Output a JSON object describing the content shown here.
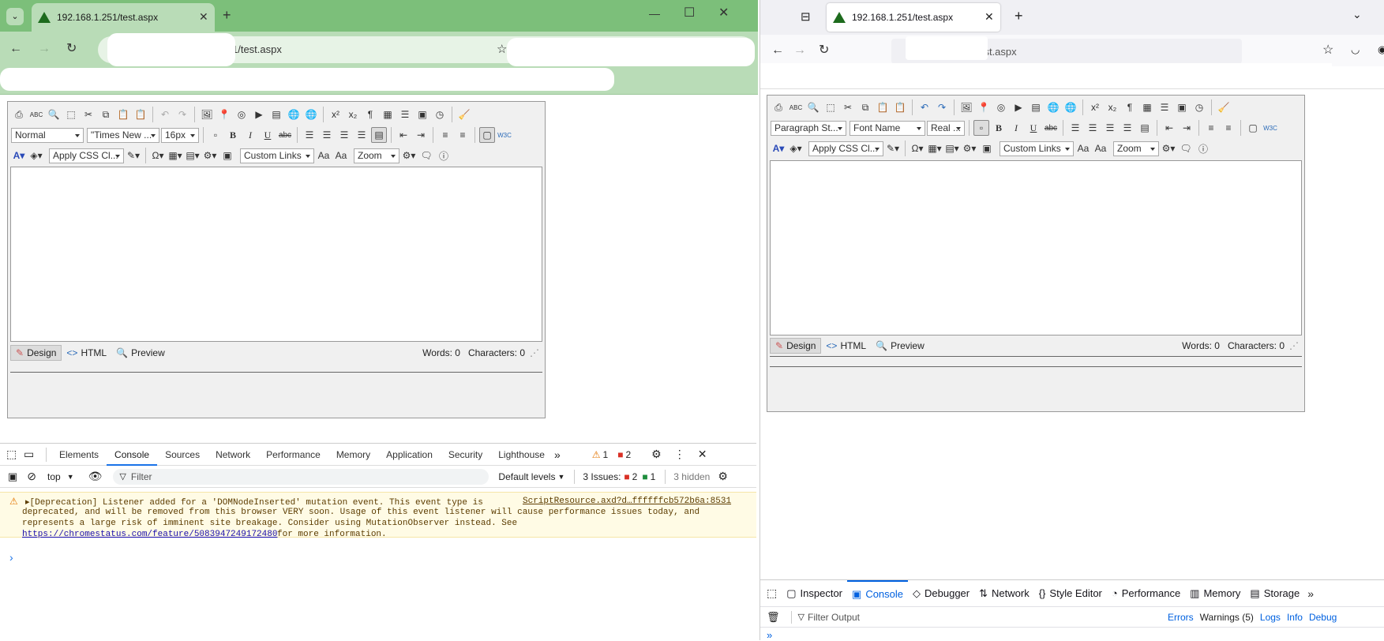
{
  "chrome": {
    "tab_title": "192.168.1.251/test.aspx",
    "url_visible": "1/test.aspx",
    "new_tab": "+",
    "window_controls": [
      "—",
      "☐",
      "✕"
    ],
    "devtools": {
      "tabs": [
        "Elements",
        "Console",
        "Sources",
        "Network",
        "Performance",
        "Memory",
        "Application",
        "Security",
        "Lighthouse"
      ],
      "more": "»",
      "warn_count": "1",
      "err_count": "2",
      "context": "top",
      "filter_placeholder": "Filter",
      "levels": "Default levels",
      "issues_label": "3 Issues:",
      "issues_err": "2",
      "issues_info": "1",
      "hidden": "3 hidden",
      "message_lines": [
        "▸[Deprecation] Listener added for a 'DOMNodeInserted' mutation event. This event type is",
        "deprecated, and will be removed from this browser VERY soon. Usage of this event listener will cause performance issues today, and",
        "represents a large risk of imminent site breakage. Consider using MutationObserver instead. See"
      ],
      "message_link": "https://chromestatus.com/feature/5083947249172480",
      "message_tail": " for more information.",
      "source_link": "ScriptResource.axd?d…ffffffcb572b6a:8531",
      "prompt": "›"
    },
    "editor": {
      "format": "Normal",
      "font": "\"Times New ...",
      "size": "16px",
      "css_class": "Apply CSS Cl...",
      "custom_links": "Custom Links",
      "zoom": "Zoom",
      "modes": [
        "Design",
        "HTML",
        "Preview"
      ],
      "words": "Words: 0",
      "chars": "Characters: 0"
    }
  },
  "firefox": {
    "tab_title": "192.168.1.251/test.aspx",
    "url_visible": "/test.aspx",
    "new_tab": "+",
    "editor": {
      "format": "Paragraph St...",
      "font": "Font Name",
      "size": "Real ...",
      "css_class": "Apply CSS Cl...",
      "custom_links": "Custom Links",
      "zoom": "Zoom",
      "modes": [
        "Design",
        "HTML",
        "Preview"
      ],
      "words": "Words: 0",
      "chars": "Characters: 0"
    },
    "devtools": {
      "tabs": [
        "Inspector",
        "Console",
        "Debugger",
        "Network",
        "Style Editor",
        "Performance",
        "Memory",
        "Storage"
      ],
      "more": "»",
      "filter_placeholder": "Filter Output",
      "levels": [
        "Errors",
        "Warnings (5)",
        "Logs",
        "Info",
        "Debug"
      ],
      "prompt": "»"
    }
  },
  "colors": {
    "chrome_tab": "#7cbf7a",
    "chrome_nav": "#b9dcb7",
    "ff_accent": "#0061e0",
    "chrome_accent": "#1a73e8"
  }
}
